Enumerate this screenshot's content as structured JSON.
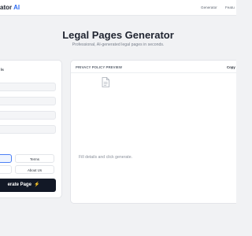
{
  "nav": {
    "brand_text": "ator",
    "brand_accent": "AI",
    "links": [
      "Generator",
      "Featu"
    ]
  },
  "hero": {
    "title": "Legal Pages Generator",
    "subtitle": "Professional, AI-generated legal pages in seconds."
  },
  "form": {
    "section_title": "ls",
    "segments": [
      "",
      "Terms",
      "",
      "About Us"
    ],
    "generate_label": "erate Page",
    "generate_icon": "⚡"
  },
  "preview": {
    "header": "PRIVACY POLICY PREVIEW",
    "copy_label": "Copy",
    "empty_message": "Fill details and click generate.",
    "icon": "document-icon"
  },
  "colors": {
    "accent": "#2f6df2",
    "button_bg": "#121826",
    "page_bg": "#f1f2f4"
  }
}
